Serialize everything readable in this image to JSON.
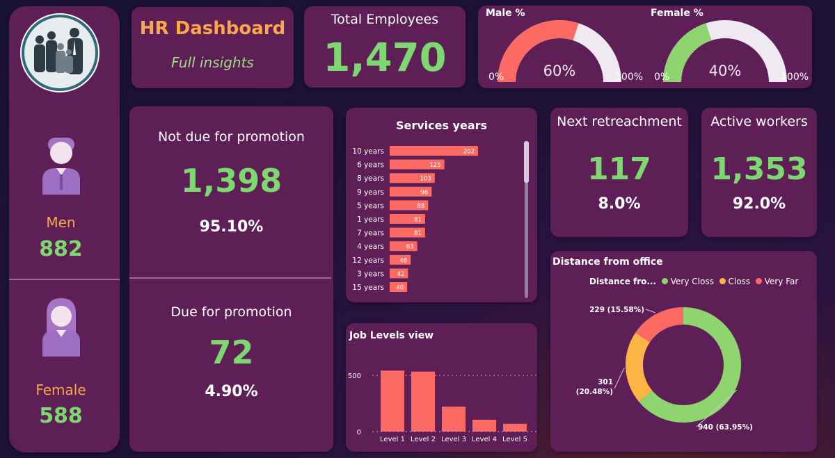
{
  "colors": {
    "background": "#1e1238",
    "card": "#5d1f55",
    "green": "#7dd86f",
    "orange": "#f7a94a",
    "coral": "#fd6a64",
    "gauge_bg": "#efe9f2"
  },
  "sidebar": {
    "men_label": "Men",
    "men_value": "882",
    "men_icon": "man-avatar-icon",
    "female_label": "Female",
    "female_value": "588",
    "female_icon": "woman-avatar-icon",
    "logo_icon": "team-silhouette-logo"
  },
  "header": {
    "title": "HR Dashboard",
    "subtitle": "Full insights"
  },
  "total_employees": {
    "label": "Total Employees",
    "value": "1,470"
  },
  "gauges": {
    "male": {
      "label": "Male %",
      "min": "0%",
      "max": "100%",
      "value_label": "60%",
      "value": 0.6
    },
    "female": {
      "label": "Female %",
      "min": "0%",
      "max": "100%",
      "value_label": "40%",
      "value": 0.4
    }
  },
  "promotion": {
    "not_due_label": "Not due for promotion",
    "not_due_value": "1,398",
    "not_due_pct": "95.10%",
    "due_label": "Due for promotion",
    "due_value": "72",
    "due_pct": "4.90%"
  },
  "retreachment": {
    "label": "Next retreachment",
    "value": "117",
    "pct": "8.0%"
  },
  "active": {
    "label": "Active workers",
    "value": "1,353",
    "pct": "92.0%"
  },
  "chart_data": [
    {
      "type": "bar",
      "orientation": "horizontal",
      "title": "Services years",
      "categories": [
        "10 years",
        "6 years",
        "8 years",
        "9 years",
        "5 years",
        "1 years",
        "7 years",
        "4 years",
        "12 years",
        "3 years",
        "15 years"
      ],
      "values": [
        202,
        125,
        103,
        96,
        88,
        81,
        81,
        63,
        48,
        42,
        40
      ],
      "xlim": [
        0,
        202
      ]
    },
    {
      "type": "bar",
      "title": "Job Levels view",
      "categories": [
        "Level 1",
        "Level 2",
        "Level 3",
        "Level 4",
        "Level 5"
      ],
      "values": [
        543,
        534,
        222,
        106,
        69
      ],
      "ylim": [
        0,
        600
      ],
      "yticks": [
        "0",
        "500"
      ],
      "grid": true
    },
    {
      "type": "pie",
      "title": "Distance from office",
      "legend_title": "Distance fro...",
      "legend_position": "top",
      "categories": [
        "Very Closs",
        "Closs",
        "Very Far"
      ],
      "values": [
        940,
        301,
        229
      ],
      "labels": [
        "940 (63.95%)",
        "301 (20.48%)",
        "229 (15.58%)"
      ],
      "colors": [
        "#8ed46f",
        "#fbb544",
        "#fd6a64"
      ]
    }
  ]
}
